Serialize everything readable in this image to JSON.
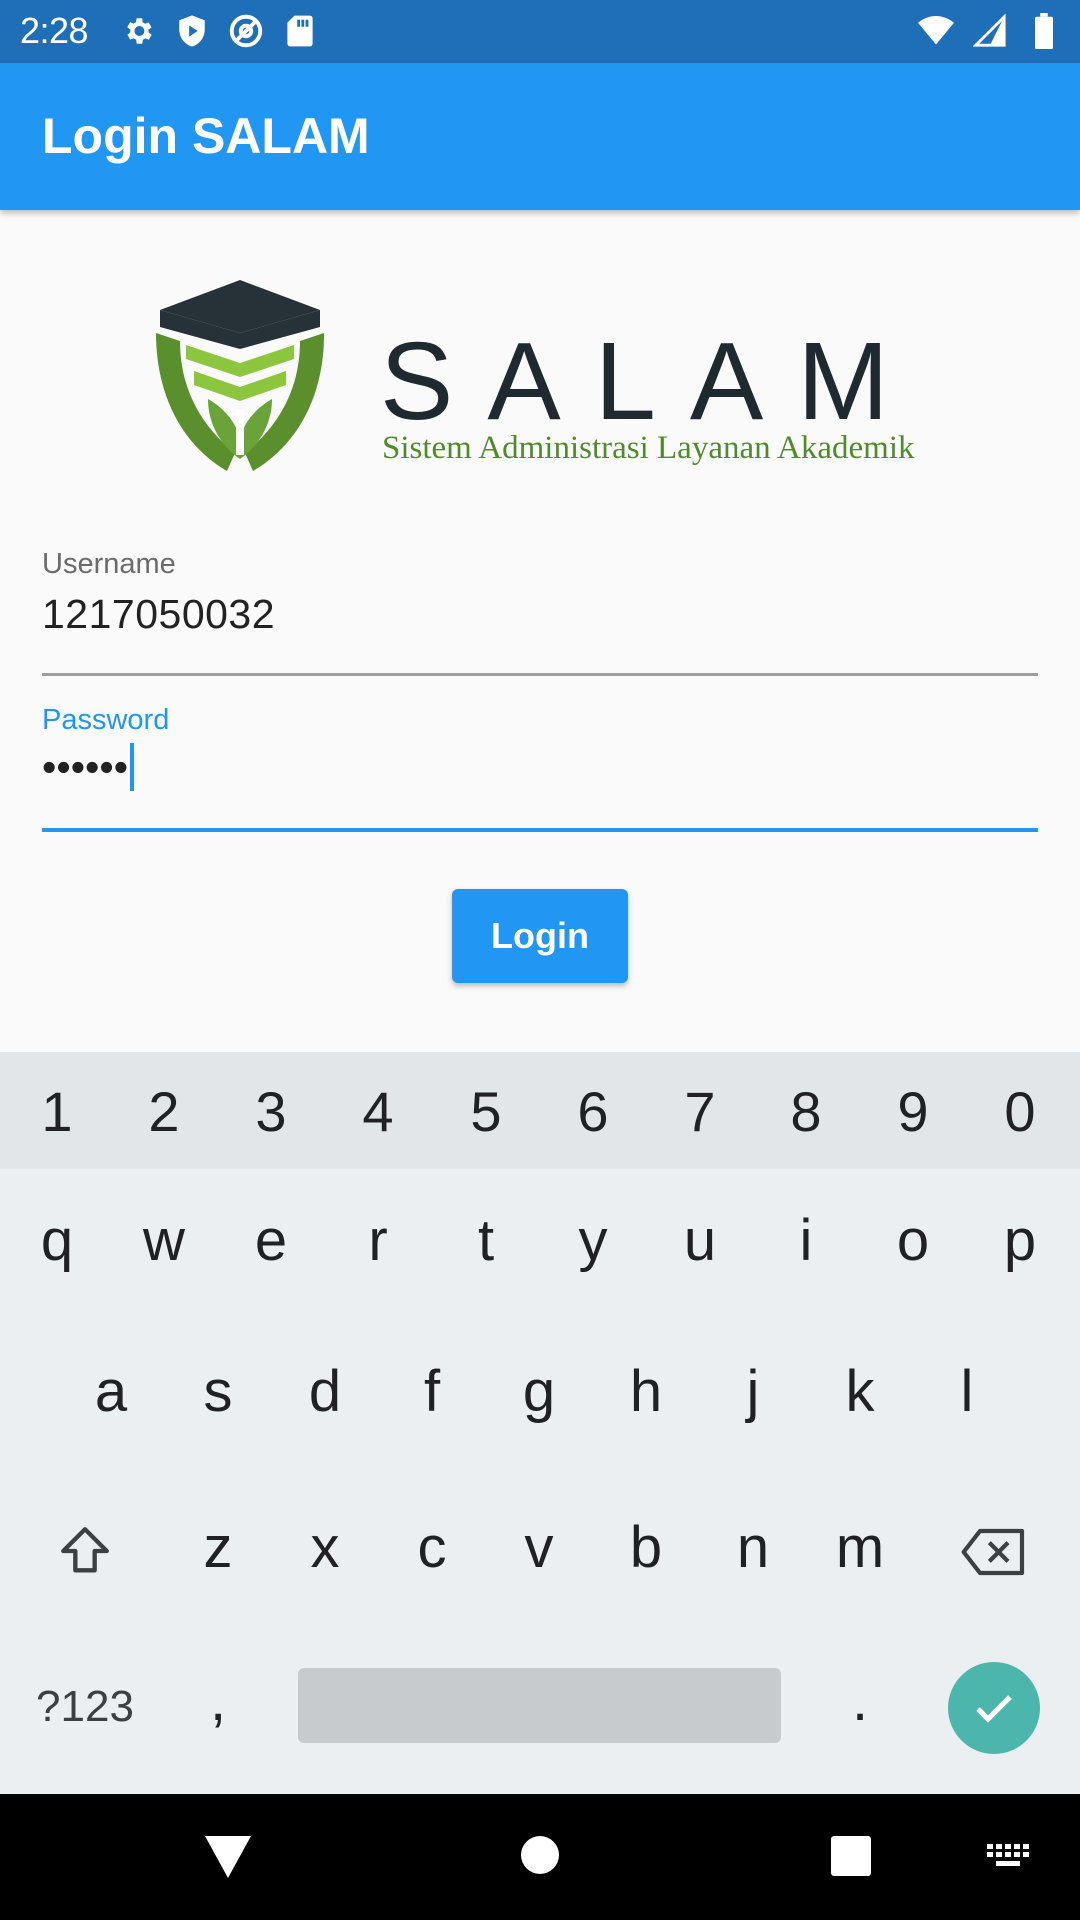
{
  "status_bar": {
    "time": "2:28",
    "icons_left": [
      "gear-icon",
      "shield-play-icon",
      "at-sign-icon",
      "sd-card-icon"
    ],
    "icons_right": [
      "wifi-icon",
      "signal-icon",
      "battery-icon"
    ]
  },
  "app_bar": {
    "title": "Login SALAM"
  },
  "logo": {
    "wordmark": "SALAM",
    "tagline": "Sistem Administrasi Layanan Akademik",
    "colors": {
      "dark": "#1f2a30",
      "green": "#4f8a2b",
      "light_green": "#8cc63f"
    }
  },
  "form": {
    "username": {
      "label": "Username",
      "value": "1217050032"
    },
    "password": {
      "label": "Password",
      "value": "••••••"
    },
    "login_label": "Login"
  },
  "keyboard": {
    "numbers": [
      "1",
      "2",
      "3",
      "4",
      "5",
      "6",
      "7",
      "8",
      "9",
      "0"
    ],
    "row1": [
      "q",
      "w",
      "e",
      "r",
      "t",
      "y",
      "u",
      "i",
      "o",
      "p"
    ],
    "row2": [
      "a",
      "s",
      "d",
      "f",
      "g",
      "h",
      "j",
      "k",
      "l"
    ],
    "row3": [
      "z",
      "x",
      "c",
      "v",
      "b",
      "n",
      "m"
    ],
    "symbols_label": "?123",
    "comma": ",",
    "period": "."
  },
  "nav_bar": {
    "icons": [
      "back-icon",
      "home-icon",
      "recents-icon",
      "keyboard-switch-icon"
    ]
  },
  "colors": {
    "accent": "#2196f3",
    "status_bar": "#1e6fb8",
    "enter": "#4db6ac"
  }
}
